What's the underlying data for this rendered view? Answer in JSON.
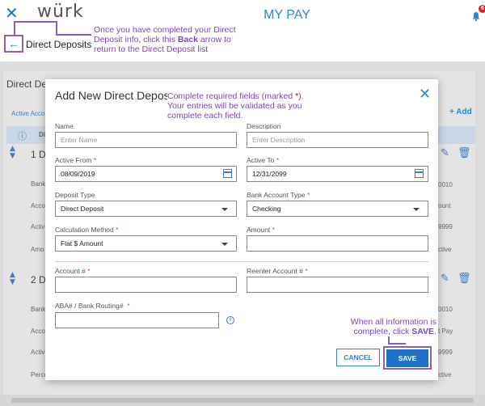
{
  "app": {
    "close_glyph": "✕",
    "logo": "würk",
    "title": "MY PAY",
    "notification_count": "6"
  },
  "subheader": {
    "back_glyph": "←",
    "title": "Direct Deposits"
  },
  "callouts": {
    "back_line1": "Once you have completed your Direct",
    "back_line2_pre": "Deposit info, click this ",
    "back_line2_bold": "Back",
    "back_line2_post": " arrow to",
    "back_line3": "return to the Direct Deposit list",
    "required_line1_pre": "Complete required fields (marked ",
    "required_line1_star": "*",
    "required_line1_post": ").",
    "required_line2": "Your entries will be validated as you",
    "required_line3": "complete each field.",
    "save_line1": "When all information is",
    "save_line2_pre": "complete, click ",
    "save_line2_bold": "SAVE",
    "save_line2_post": "."
  },
  "background": {
    "section_title": "Direct Dep",
    "active_accounts": "Active Acco",
    "add_label": "+ Add",
    "col_head": "Di",
    "group1": "1 Di",
    "group2": "2 Di",
    "rows_left": [
      "Bank",
      "Acco",
      "Activ",
      "Amo",
      "Bank",
      "Acco",
      "Activ",
      "Perce"
    ],
    "rows_right": [
      "0010",
      "ount",
      "9999",
      "ctive",
      "0010",
      "t Pay",
      "9999",
      "ctive"
    ]
  },
  "modal": {
    "title": "Add New Direct Deposit",
    "close_glyph": "✕",
    "required_mark": "*",
    "name_label": "Name",
    "name_placeholder": "Enter Name",
    "description_label": "Description",
    "description_placeholder": "Enter Description",
    "active_from_label": "Active From",
    "active_from_value": "08/09/2019",
    "active_to_label": "Active To",
    "active_to_value": "12/31/2099",
    "deposit_type_label": "Deposit Type",
    "deposit_type_value": "Direct Deposit",
    "bank_account_type_label": "Bank Account Type",
    "bank_account_type_value": "Checking",
    "calc_method_label": "Calculation Method",
    "calc_method_value": "Flat $ Amount",
    "amount_label": "Amount",
    "account_label": "Account #",
    "reenter_label": "Reenter Account #",
    "aba_label": "ABA# / Bank Routing#",
    "cancel_label": "CANCEL",
    "save_label": "SAVE"
  },
  "colors": {
    "accent": "#1d73c9",
    "annotation": "#7f45b8",
    "required": "#e04545"
  }
}
